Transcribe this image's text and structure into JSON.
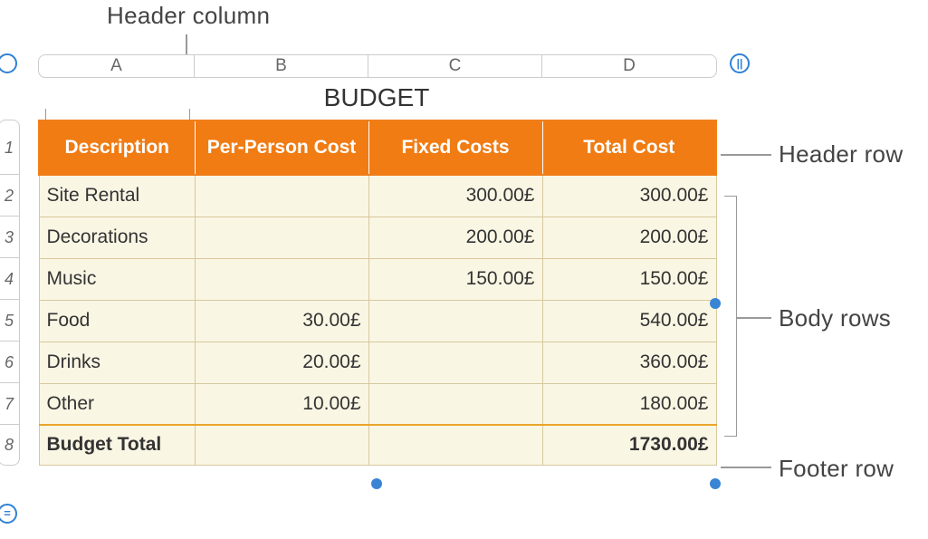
{
  "annotations": {
    "header_column": "Header column",
    "header_row": "Header row",
    "body_rows": "Body rows",
    "footer_row": "Footer row"
  },
  "column_letters": [
    "A",
    "B",
    "C",
    "D"
  ],
  "row_numbers": [
    "1",
    "2",
    "3",
    "4",
    "5",
    "6",
    "7",
    "8"
  ],
  "handles": {
    "col_add_glyph": "||",
    "row_add_glyph": "="
  },
  "table": {
    "title": "BUDGET",
    "headers": [
      "Description",
      "Per-Person Cost",
      "Fixed Costs",
      "Total Cost"
    ],
    "rows": [
      {
        "label": "Site Rental",
        "per_person": "",
        "fixed": "300.00£",
        "total": "300.00£"
      },
      {
        "label": "Decorations",
        "per_person": "",
        "fixed": "200.00£",
        "total": "200.00£"
      },
      {
        "label": "Music",
        "per_person": "",
        "fixed": "150.00£",
        "total": "150.00£"
      },
      {
        "label": "Food",
        "per_person": "30.00£",
        "fixed": "",
        "total": "540.00£"
      },
      {
        "label": "Drinks",
        "per_person": "20.00£",
        "fixed": "",
        "total": "360.00£"
      },
      {
        "label": "Other",
        "per_person": "10.00£",
        "fixed": "",
        "total": "180.00£"
      }
    ],
    "footer": {
      "label": "Budget Total",
      "per_person": "",
      "fixed": "",
      "total": "1730.00£"
    }
  }
}
